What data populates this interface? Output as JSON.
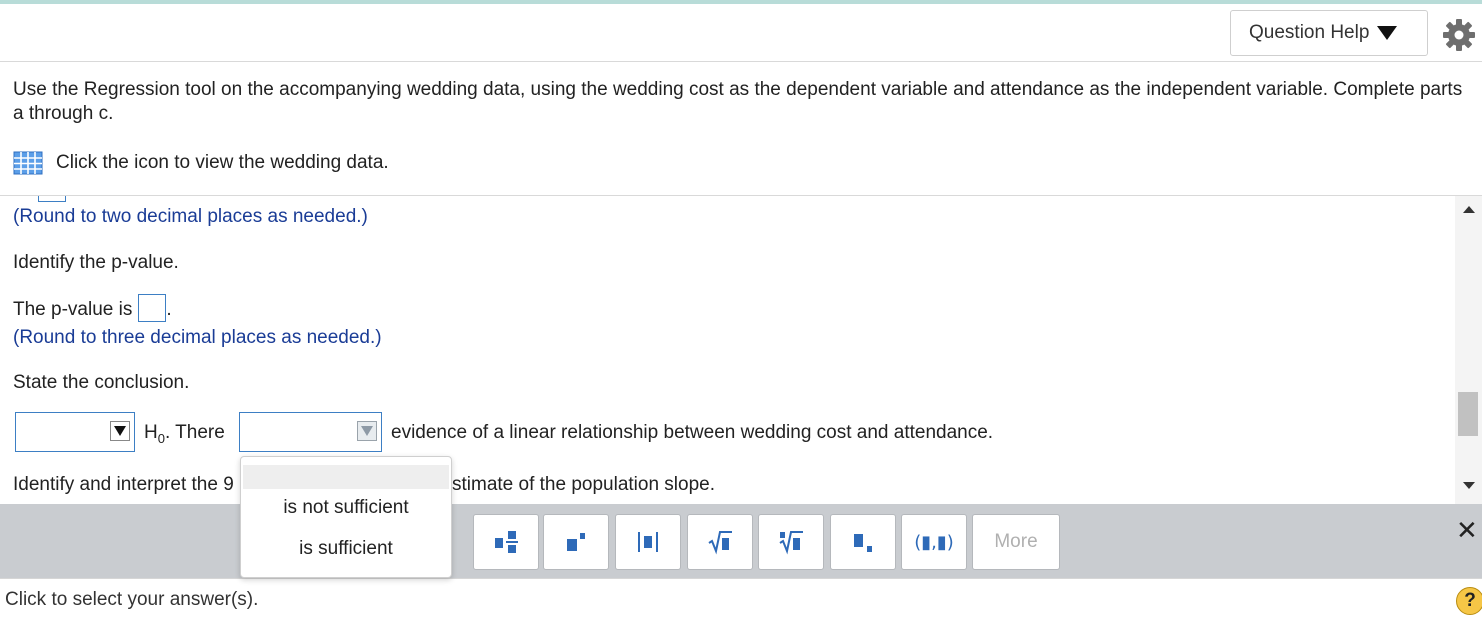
{
  "header": {
    "question_help_label": "Question Help"
  },
  "question": {
    "text": "Use the Regression tool on the accompanying wedding data, using the wedding cost as the dependent variable and attendance as the independent variable. Complete parts a through c.",
    "data_link": "Click the icon to view the wedding data."
  },
  "work": {
    "round_two": "(Round to two decimal places as needed.)",
    "identify_pvalue": "Identify the p-value.",
    "pvalue_prefix": "The p-value is",
    "pvalue_suffix": ".",
    "round_three": "(Round to three decimal places as needed.)",
    "state_conclusion": "State the conclusion.",
    "h0_letter": "H",
    "h0_sub": "0",
    "h0_suffix": ". There",
    "evidence_text": "evidence of a linear relationship between wedding cost and attendance.",
    "interpret_prefix": "Identify and interpret the 9",
    "interpret_suffix": "stimate of the population slope."
  },
  "dropdown": {
    "options": [
      "",
      "is not sufficient",
      "is sufficient"
    ]
  },
  "toolbar": {
    "buttons": [
      "fraction-icon",
      "exponent-icon",
      "absolute-value-icon",
      "sqrt-icon",
      "nth-root-icon",
      "subscript-icon",
      "interval-icon"
    ],
    "interval_label": "(▮,▮)",
    "more_label": "More"
  },
  "status": {
    "text": "Click to select your answer(s).",
    "help_label": "?"
  },
  "colors": {
    "accent_blue": "#3d7fc4",
    "hint_blue": "#1a3c96",
    "toolbar_bg": "#c9ccd0",
    "help_yellow": "#f6c646"
  }
}
